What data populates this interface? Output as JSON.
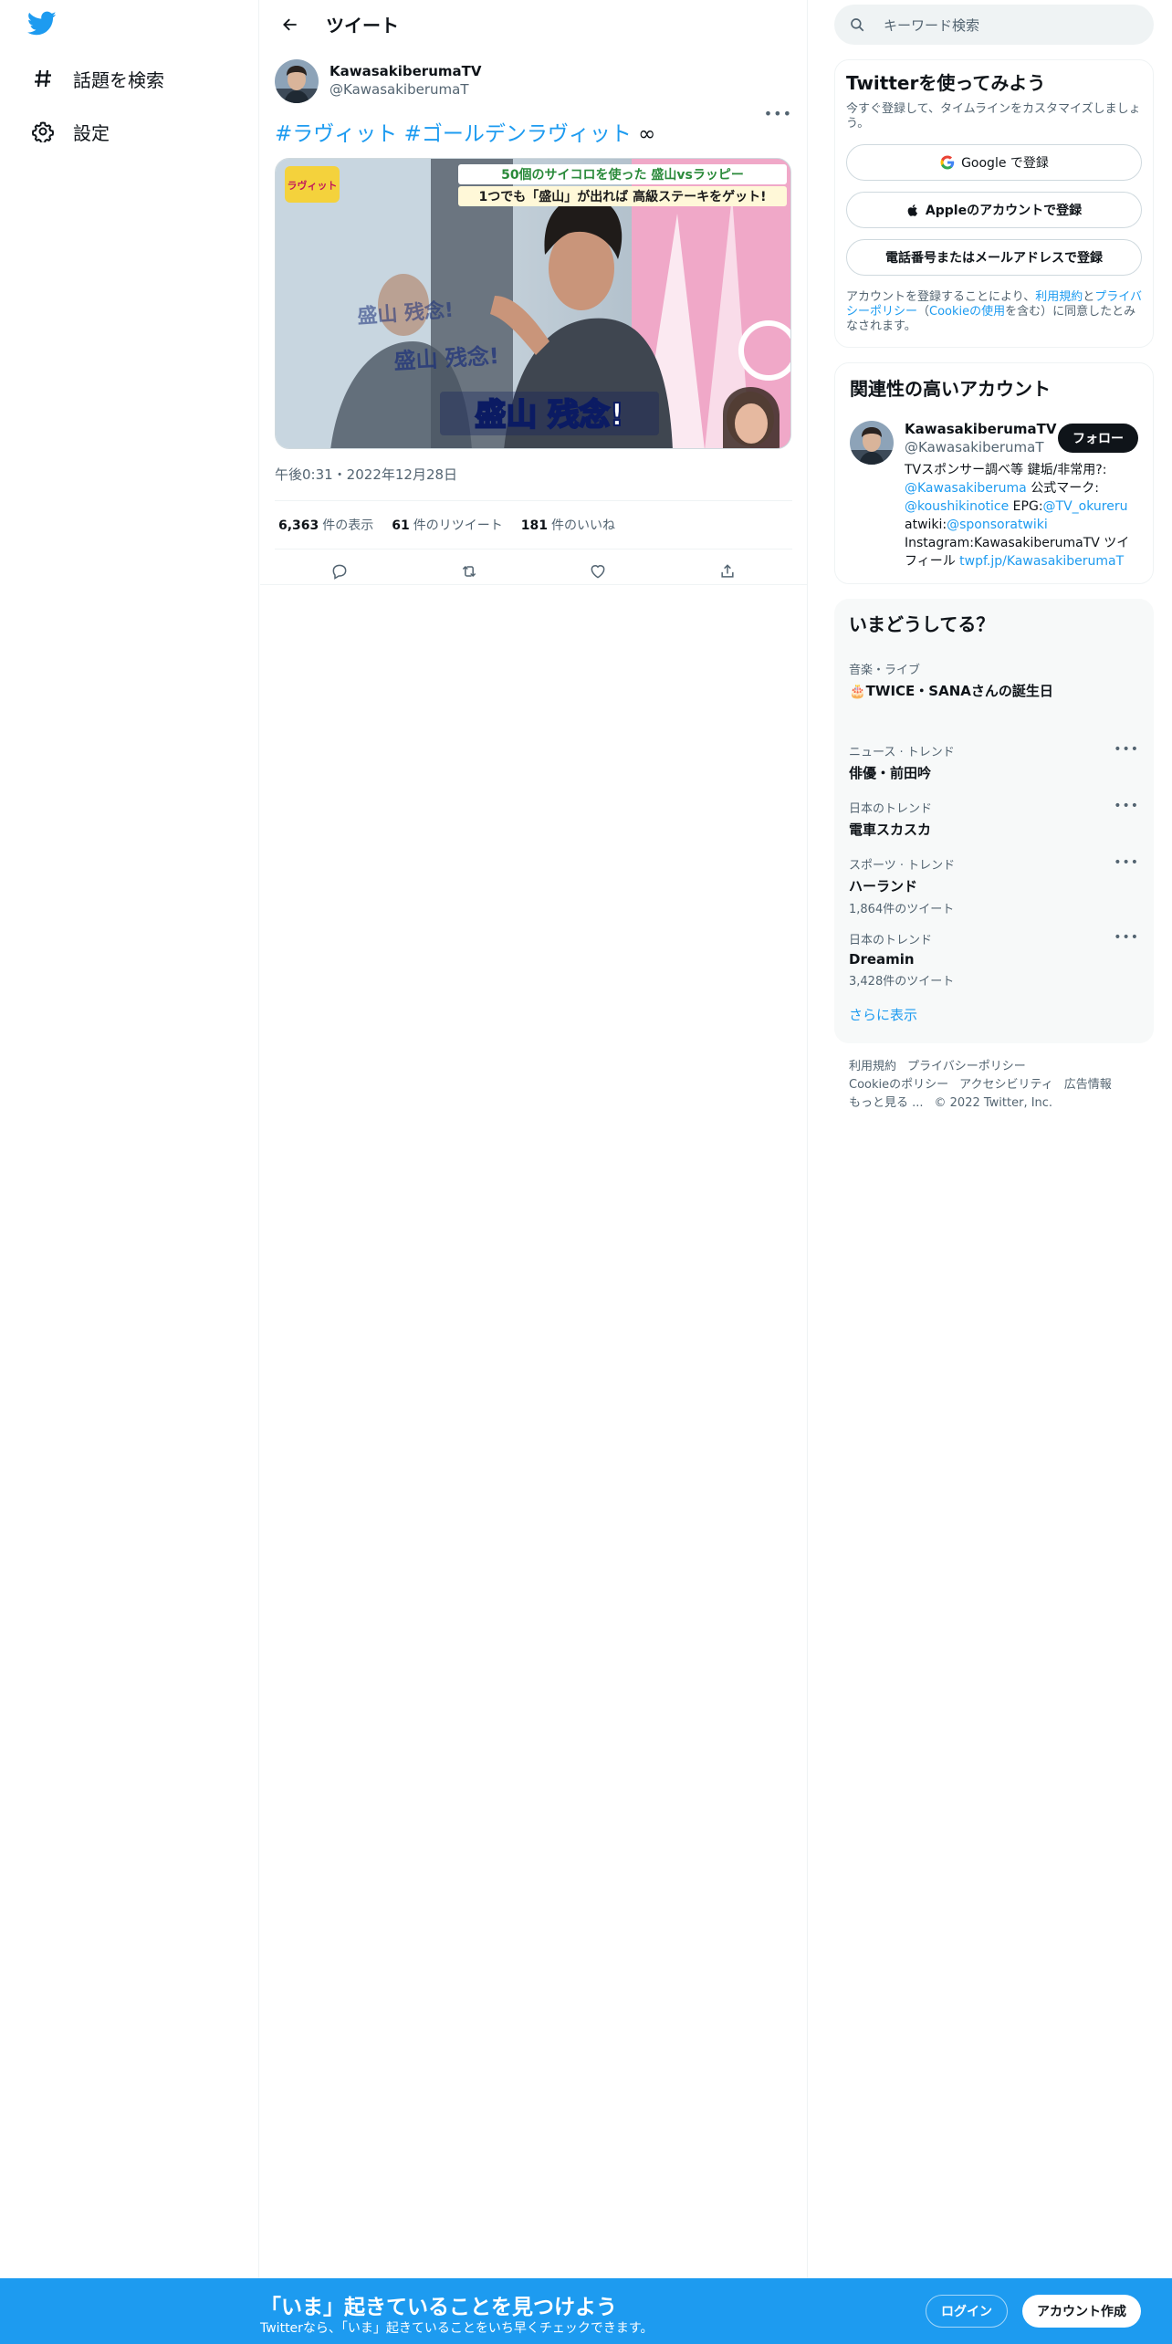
{
  "colors": {
    "brand": "#1d9bf0",
    "text": "#0f1419",
    "muted": "#536471"
  },
  "nav": {
    "logo_icon": "twitter-bird-icon",
    "explore_label": "話題を検索",
    "settings_label": "設定"
  },
  "header": {
    "title": "ツイート"
  },
  "tweet": {
    "author_name": "KawasakiberumaTV",
    "author_handle": "@KawasakiberumaT",
    "hashtag1": "#ラヴィット",
    "hashtag2": "#ゴールデンラヴィット",
    "text_tail": " ∞",
    "media_captions": {
      "top_line": "50個のサイコロを使った 盛山vsラッピー",
      "second_line": "1つでも「盛山」が出れば 高級ステーキをゲット!",
      "main_caption": "盛山 残念!",
      "corner_logo": "ラヴィット"
    },
    "timestamp": "午後0:31・2022年12月28日",
    "views_count": "6,363",
    "views_label": "件の表示",
    "retweets_count": "61",
    "retweets_label": "件のリツイート",
    "likes_count": "181",
    "likes_label": "件のいいね"
  },
  "sidebar": {
    "search_placeholder": "キーワード検索",
    "signup": {
      "title": "Twitterを使ってみよう",
      "subtitle": "今すぐ登録して、タイムラインをカスタマイズしましょう。",
      "google_label": "Google で登録",
      "apple_label": "Appleのアカウントで登録",
      "phone_label": "電話番号またはメールアドレスで登録",
      "legal_prefix": "アカウントを登録することにより、",
      "legal_terms": "利用規約",
      "legal_and": "と",
      "legal_privacy": "プライバシーポリシー",
      "legal_open": "（",
      "legal_cookie": "Cookieの使用",
      "legal_suffix": "を含む）に同意したとみなされます。"
    },
    "related": {
      "title": "関連性の高いアカウント",
      "name": "KawasakiberumaTV",
      "handle": "@KawasakiberumaT",
      "follow_label": "フォロー",
      "bio_1": "TVスポンサー調べ等 鍵垢/非常用?:",
      "bio_link1": "@Kawasakiberuma",
      "bio_2": " 公式マーク:",
      "bio_link2": "@koushikinotice",
      "bio_3": " EPG:",
      "bio_link3": "@TV_okureru",
      "bio_4": "atwiki:",
      "bio_link4": "@sponsoratwiki",
      "bio_5": "Instagram:KawasakiberumaTV ツイフィール ",
      "bio_link5": "twpf.jp/KawasakiberumaT"
    },
    "trends": {
      "title": "いまどうしてる？",
      "items": [
        {
          "meta": "音楽・ライブ",
          "title": "🎂TWICE・SANAさんの誕生日",
          "count": ""
        },
        {
          "meta": "ニュース · トレンド",
          "title": "俳優・前田吟",
          "count": ""
        },
        {
          "meta": "日本のトレンド",
          "title": "電車スカスカ",
          "count": ""
        },
        {
          "meta": "スポーツ · トレンド",
          "title": "ハーランド",
          "count": "1,864件のツイート"
        },
        {
          "meta": "日本のトレンド",
          "title": "Dreamin",
          "count": "3,428件のツイート"
        }
      ],
      "show_more": "さらに表示"
    },
    "footer": {
      "terms": "利用規約",
      "privacy": "プライバシーポリシー",
      "cookie": "Cookieのポリシー",
      "accessibility": "アクセシビリティ",
      "ads": "広告情報",
      "more": "もっと見る ...",
      "copyright": "© 2022 Twitter, Inc."
    }
  },
  "banner": {
    "title": "「いま」起きていることを見つけよう",
    "subtitle": "Twitterなら、「いま」起きていることをいち早くチェックできます。",
    "login_label": "ログイン",
    "signup_label": "アカウント作成"
  }
}
